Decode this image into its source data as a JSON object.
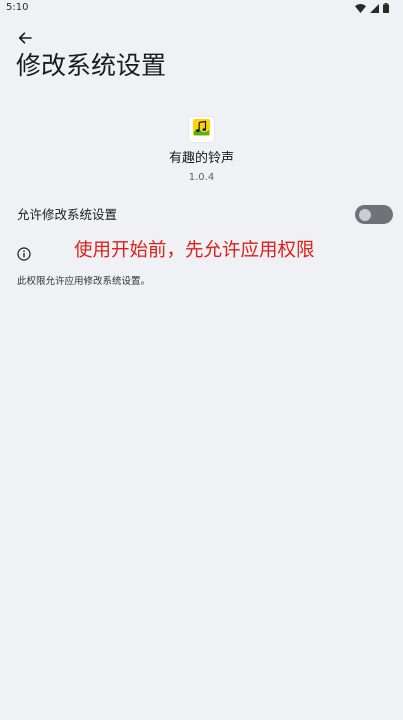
{
  "status_bar": {
    "time": "5:10",
    "icons": [
      "wifi-icon",
      "signal-icon",
      "battery-icon"
    ]
  },
  "header": {
    "back_icon": "arrow-back-icon",
    "title": "修改系统设置"
  },
  "app": {
    "icon": "music-note-icon",
    "name": "有趣的铃声",
    "version": "1.0.4"
  },
  "setting": {
    "label": "允许修改系统设置",
    "toggle_on": false
  },
  "info": {
    "icon": "info-icon",
    "annotation": "使用开始前，先允许应用权限",
    "annotation_color": "#e0201b",
    "description": "此权限允许应用修改系统设置。"
  },
  "colors": {
    "background": "#f0f1f4",
    "switch_track": "#6f7277",
    "switch_thumb": "#c9ccd2"
  }
}
